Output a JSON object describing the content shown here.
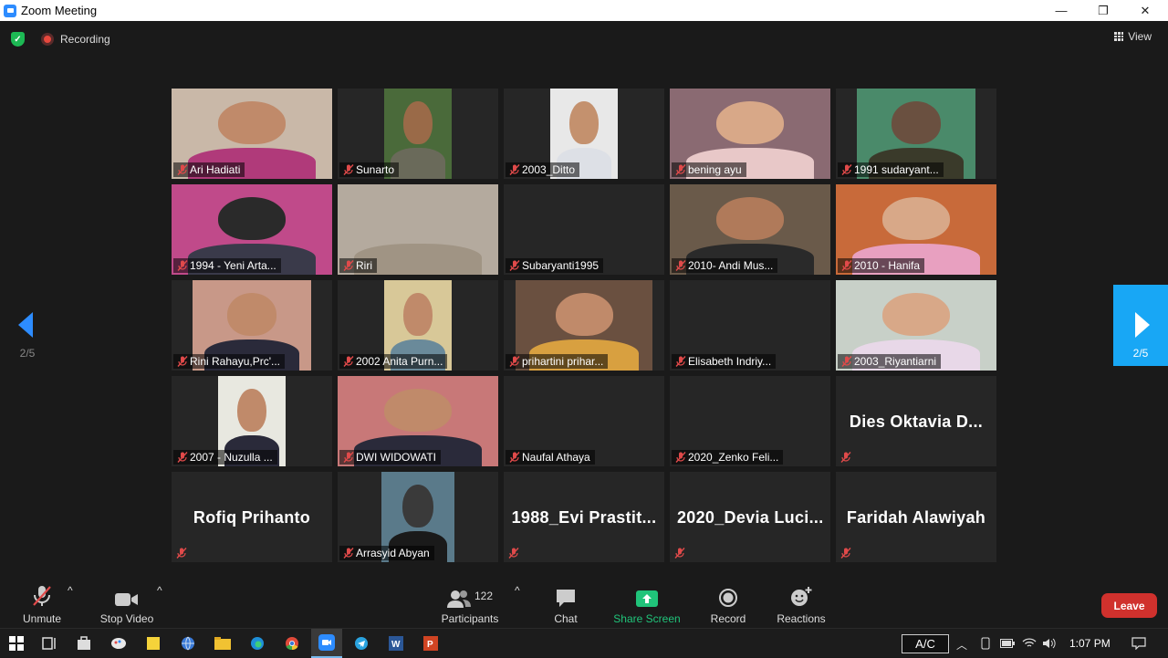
{
  "window": {
    "title": "Zoom Meeting",
    "minimize": "—",
    "maximize": "❐",
    "close": "✕"
  },
  "top": {
    "recording_label": "Recording",
    "view_label": "View"
  },
  "pager": {
    "current": "2/5"
  },
  "tiles": [
    {
      "name": "Ari Hadiati",
      "video": true,
      "bg": "#c9b8a8",
      "skin": "#c08a6a",
      "cloth": "#b03a7a",
      "vw": 176
    },
    {
      "name": "Sunarto",
      "video": true,
      "bg": "#4a6a3a",
      "skin": "#9a6a48",
      "cloth": "#6a6a5a",
      "vw": 74
    },
    {
      "name": "2003_Ditto",
      "video": true,
      "bg": "#e8e8e8",
      "skin": "#c4916e",
      "cloth": "#dde0e6",
      "vw": 74
    },
    {
      "name": "bening ayu",
      "video": true,
      "bg": "#8a6a72",
      "skin": "#d8a888",
      "cloth": "#e8c8c8",
      "vw": 176
    },
    {
      "name": "1991 sudaryant...",
      "video": true,
      "bg": "#4a8a6a",
      "skin": "#6a5040",
      "cloth": "#3a3a2a",
      "vw": 130
    },
    {
      "name": "1994 - Yeni Arta...",
      "video": true,
      "bg": "#c04a8a",
      "skin": "#2a2a2a",
      "cloth": "#3a3a4a",
      "vw": 176
    },
    {
      "name": "Riri",
      "video": true,
      "bg": "#b4aa9e",
      "skin": "#b4aa9e",
      "cloth": "#a09484",
      "vw": 176
    },
    {
      "name": "Subaryanti1995",
      "video": false
    },
    {
      "name": "2010- Andi Mus...",
      "video": true,
      "bg": "#6a5a4a",
      "skin": "#b07a5a",
      "cloth": "#2a2a2a",
      "vw": 176
    },
    {
      "name": "2010 - Hanifa",
      "video": true,
      "bg": "#c86a3a",
      "skin": "#d8a888",
      "cloth": "#e8a0c0",
      "vw": 176
    },
    {
      "name": "Rini Rahayu,Prc'...",
      "video": true,
      "bg": "#c89888",
      "skin": "#c08a6a",
      "cloth": "#2a2a3a",
      "vw": 130
    },
    {
      "name": "2002 Anita Purn...",
      "video": true,
      "bg": "#d8c898",
      "skin": "#c08a6a",
      "cloth": "#6a8a9a",
      "vw": 74
    },
    {
      "name": "prihartini prihar...",
      "video": true,
      "bg": "#6a5040",
      "skin": "#c08a6a",
      "cloth": "#d8a040",
      "vw": 150
    },
    {
      "name": "Elisabeth Indriy...",
      "video": false
    },
    {
      "name": "2003_Riyantiarni",
      "video": true,
      "bg": "#c8d0c8",
      "skin": "#d8a888",
      "cloth": "#e8d8e8",
      "vw": 176
    },
    {
      "name": "2007 - Nuzulla ...",
      "video": true,
      "bg": "#e8e8e0",
      "skin": "#c08a6a",
      "cloth": "#2a2a3a",
      "vw": 74
    },
    {
      "name": "DWI WIDOWATI",
      "video": true,
      "bg": "#c87878",
      "skin": "#c08a6a",
      "cloth": "#2a2a3a",
      "vw": 176
    },
    {
      "name": "Naufal Athaya",
      "video": false
    },
    {
      "name": "2020_Zenko Feli...",
      "video": false
    },
    {
      "name": "Dies  Oktavia  D...",
      "video": false,
      "big": true
    },
    {
      "name": "Rofiq Prihanto",
      "video": false,
      "big": true
    },
    {
      "name": "Arrasyid Abyan",
      "video": true,
      "bg": "#5a7a8a",
      "skin": "#3a3a3a",
      "cloth": "#1a1a1a",
      "vw": 80
    },
    {
      "name": "1988_Evi  Prastit...",
      "video": false,
      "big": true
    },
    {
      "name": "2020_Devia  Luci...",
      "video": false,
      "big": true
    },
    {
      "name": "Faridah Alawiyah",
      "video": false,
      "big": true
    }
  ],
  "toolbar": {
    "unmute": "Unmute",
    "stop_video": "Stop Video",
    "participants_count": "122",
    "participants": "Participants",
    "chat": "Chat",
    "share_screen": "Share Screen",
    "record": "Record",
    "reactions": "Reactions",
    "leave": "Leave"
  },
  "taskbar": {
    "ac_label": "A/C",
    "clock": "1:07 PM"
  },
  "colors": {
    "accent": "#2d8cff",
    "leave": "#d0312d",
    "share": "#20c47a",
    "mute": "#e04a4a",
    "pager_active": "#18a7f5"
  }
}
